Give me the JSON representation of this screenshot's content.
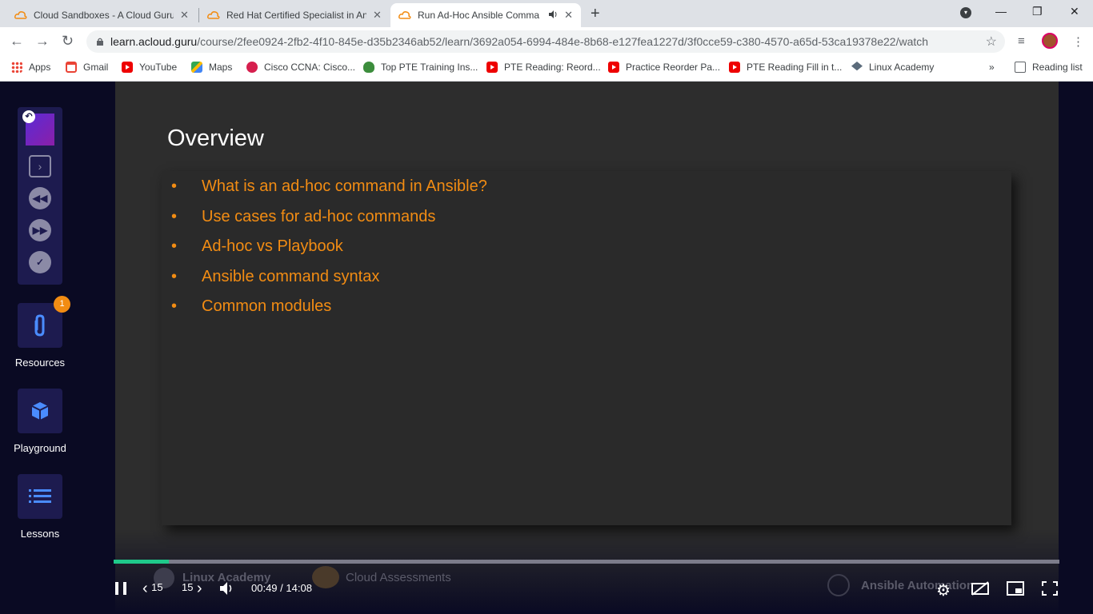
{
  "browser": {
    "tabs": [
      {
        "title": "Cloud Sandboxes - A Cloud Guru",
        "active": false
      },
      {
        "title": "Red Hat Certified Specialist in An",
        "active": false
      },
      {
        "title": "Run Ad-Hoc Ansible Comma",
        "active": true
      }
    ],
    "close_glyph": "✕",
    "new_tab_glyph": "+",
    "window_controls": {
      "minimize": "—",
      "maximize": "❐",
      "close": "✕"
    },
    "url_host": "learn.acloud.guru",
    "url_path": "/course/2fee0924-2fb2-4f10-845e-d35b2346ab52/learn/3692a054-6994-484e-8b68-e127fea1227d/3f0cce59-c380-4570-a65d-53ca19378e22/watch",
    "bookmarks": [
      {
        "label": "Apps",
        "icon": "apps-grid-icon"
      },
      {
        "label": "Gmail",
        "icon": "gmail-icon"
      },
      {
        "label": "YouTube",
        "icon": "youtube-icon"
      },
      {
        "label": "Maps",
        "icon": "maps-icon"
      },
      {
        "label": "Cisco CCNA: Cisco...",
        "icon": "cisco-icon"
      },
      {
        "label": "Top PTE Training Ins...",
        "icon": "pte-icon"
      },
      {
        "label": "PTE Reading: Reord...",
        "icon": "youtube-icon"
      },
      {
        "label": "Practice Reorder Pa...",
        "icon": "youtube-icon"
      },
      {
        "label": "PTE Reading Fill in t...",
        "icon": "youtube-icon"
      },
      {
        "label": "Linux Academy",
        "icon": "graduation-cap-icon"
      }
    ],
    "bookmarks_overflow": "»",
    "reading_list": "Reading list"
  },
  "sidebar": {
    "resources_label": "Resources",
    "resources_badge": "1",
    "playground_label": "Playground",
    "lessons_label": "Lessons"
  },
  "slide": {
    "title": "Overview",
    "bullets": [
      "What is an ad-hoc command in Ansible?",
      "Use cases for ad-hoc commands",
      "Ad-hoc vs Playbook",
      "Ansible command syntax",
      "Common modules"
    ],
    "watermark_left": "Linux Academy",
    "watermark_mid": "Cloud Assessments",
    "watermark_right": "Ansible Automation"
  },
  "player": {
    "rewind_seconds": "15",
    "forward_seconds": "15",
    "current_time": "00:49",
    "duration": "14:08",
    "progress_fraction": 0.058
  },
  "colors": {
    "accent_orange": "#f28c13",
    "progress_green": "#1fc98a",
    "sidebar_bg": "#1d1b4f"
  }
}
